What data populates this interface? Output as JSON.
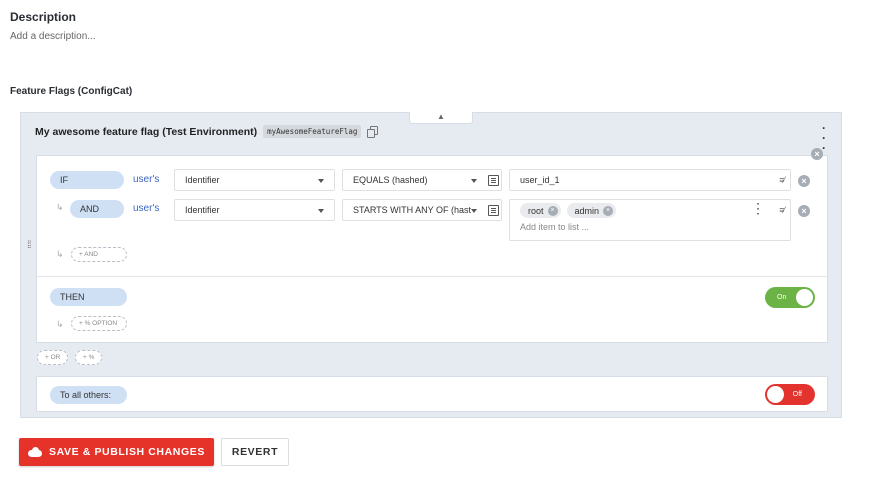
{
  "description": {
    "title": "Description",
    "placeholder": "Add a description..."
  },
  "feature_flags": {
    "section_title": "Feature Flags (ConfigCat)",
    "flag": {
      "name": "My awesome feature flag (Test Environment)",
      "key": "myAwesomeFeatureFlag",
      "rule": {
        "conditions": [
          {
            "keyword": "IF",
            "users_label": "user's",
            "attribute": "Identifier",
            "comparator": "EQUALS (hashed)",
            "value": "user_id_1"
          },
          {
            "keyword": "AND",
            "users_label": "user's",
            "attribute": "Identifier",
            "comparator": "STARTS WITH ANY OF (hast",
            "chips": [
              "root",
              "admin"
            ],
            "add_item_placeholder": "Add item to list ..."
          }
        ],
        "add_and_label": "+ AND",
        "then_label": "THEN",
        "add_percent_option_label": "+ % OPTION",
        "then_toggle": {
          "label": "On",
          "state": true
        }
      },
      "add_or_label": "+ OR",
      "add_percent_label": "+ %",
      "to_all_others": {
        "label": "To all others:",
        "toggle": {
          "label": "Off",
          "state": false
        }
      }
    }
  },
  "actions": {
    "save_publish_label": "SAVE & PUBLISH CHANGES",
    "revert_label": "REVERT"
  },
  "colors": {
    "primary_red": "#e6332a",
    "toggle_on": "#6ab344",
    "toggle_off": "#e2332e",
    "pill_blue": "#cfe0f5",
    "link_blue": "#3a66c4"
  },
  "icons": [
    "copy-icon",
    "kebab-menu-icon",
    "chevron-up-icon",
    "close-icon",
    "drag-handle-icon",
    "list-icon",
    "edit-icon",
    "cloud-upload-icon",
    "subdirectory-arrow-icon"
  ]
}
